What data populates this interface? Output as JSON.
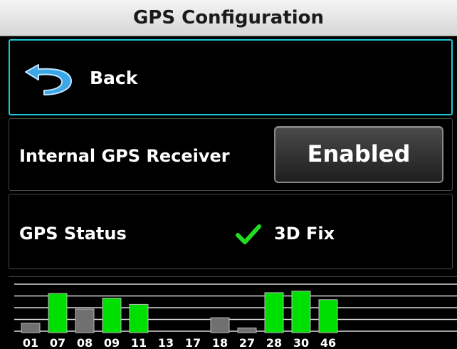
{
  "header": {
    "title": "GPS Configuration"
  },
  "back_button": {
    "label": "Back",
    "icon": "back-arrow-icon"
  },
  "internal_gps": {
    "label": "Internal GPS Receiver",
    "button_label": "Enabled"
  },
  "gps_status": {
    "label": "GPS Status",
    "icon": "checkmark-icon",
    "value": "3D Fix"
  },
  "colors": {
    "accent_border": "#1ec8d8",
    "signal_used": "#00e000",
    "signal_unused": "#707070",
    "check": "#22dd22"
  },
  "chart_data": {
    "type": "bar",
    "categories": [
      "01",
      "07",
      "08",
      "09",
      "11",
      "13",
      "17",
      "18",
      "27",
      "28",
      "30",
      "46"
    ],
    "series": [
      {
        "values": [
          1.2,
          5.0,
          3.0,
          4.4,
          3.6,
          0,
          0,
          1.9,
          0.6,
          5.1,
          5.3,
          4.2
        ]
      }
    ],
    "in_use": [
      false,
      true,
      false,
      true,
      true,
      false,
      false,
      false,
      false,
      true,
      true,
      true
    ],
    "ylim": [
      0,
      6
    ],
    "grid": true
  }
}
